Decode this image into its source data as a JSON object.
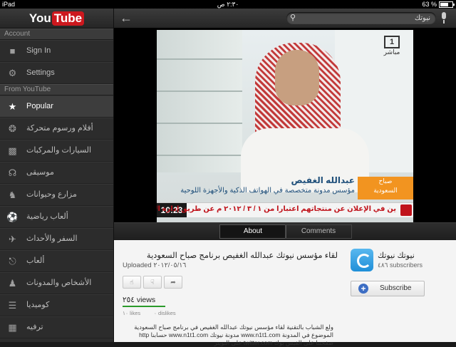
{
  "status_bar": {
    "device": "iPad",
    "time": "٢:٣٠ ص",
    "battery": "63 %",
    "battery_level": 0.63
  },
  "sidebar": {
    "logo_you": "You",
    "logo_tube": "Tube",
    "account_header": "Account",
    "account_items": [
      {
        "label": "Sign In",
        "icon": "user-icon"
      },
      {
        "label": "Settings",
        "icon": "gear-icon"
      }
    ],
    "from_header": "From YouTube",
    "categories": [
      {
        "label": "Popular",
        "icon": "star-icon",
        "active": true
      },
      {
        "label": "أفلام ورسوم متحركة",
        "icon": "film-reel-icon"
      },
      {
        "label": "السيارات والمركبات",
        "icon": "car-icon"
      },
      {
        "label": "موسيقى",
        "icon": "headphones-icon"
      },
      {
        "label": "مزارع وحيوانات",
        "icon": "dog-icon"
      },
      {
        "label": "ألعاب رياضية",
        "icon": "ball-icon"
      },
      {
        "label": "السفر والأحداث",
        "icon": "plane-icon"
      },
      {
        "label": "ألعاب",
        "icon": "gamepad-icon"
      },
      {
        "label": "الأشخاص والمدونات",
        "icon": "people-icon"
      },
      {
        "label": "كوميديا",
        "icon": "comedy-icon"
      },
      {
        "label": "ترفيه",
        "icon": "clapper-icon"
      }
    ]
  },
  "topbar": {
    "search_value": "نيوتك"
  },
  "video": {
    "channel_logo": "1",
    "channel_logo_sub": "مباشر",
    "name": "عبدالله الغفيص",
    "title_line": "مؤسس مدونة متخصصة في الهواتف الذكية والأجهزة اللوحية",
    "badge_top": "صباح",
    "badge_bottom": "السعودية",
    "clock": "10:23",
    "ticker": "ين في الإعلان عن منتجاتهم اعتبارا من ١ / ٣ / ٢٠١٢ م عن طريق إدارة الإعلان"
  },
  "tabs": [
    {
      "label": "About",
      "active": true
    },
    {
      "label": "Comments",
      "active": false
    }
  ],
  "info": {
    "title": "لقاء مؤسس نيوتك عبدالله الغفيص برنامج صباح السعودية",
    "uploaded": "Uploaded ٢٠١٢/٠٥/١٦",
    "views": "٢٥٤ views",
    "likes": "١٠ likes",
    "dislikes": "٠ dislikes",
    "description": "ولع الشباب بالتقنية لقاء مؤسس نيوتك عبدالله الغفيص في برنامج صباح السعودية الموضوع في المدونة www.n1t1.com مدونة نيوتك www.n1t1.com حسابنا http صفحتنا على الفيس بوك twitter.com على التويتر",
    "channel_name": "نيوتك نيوتك",
    "subscribers": "٤٨٦ subscribers",
    "subscribe_label": "Subscribe"
  },
  "colors": {
    "accent": "#cc181e",
    "views_underline": "#2a9a2a",
    "subscribe_plus": "#3d6ec4"
  }
}
